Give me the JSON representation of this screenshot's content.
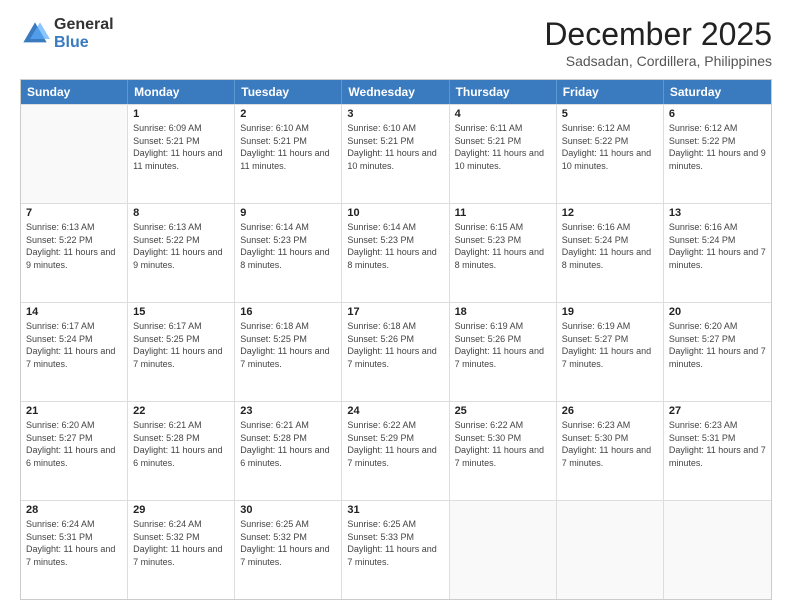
{
  "logo": {
    "general": "General",
    "blue": "Blue"
  },
  "title": "December 2025",
  "subtitle": "Sadsadan, Cordillera, Philippines",
  "days_of_week": [
    "Sunday",
    "Monday",
    "Tuesday",
    "Wednesday",
    "Thursday",
    "Friday",
    "Saturday"
  ],
  "weeks": [
    [
      {
        "day": "",
        "sunrise": "",
        "sunset": "",
        "daylight": ""
      },
      {
        "day": "1",
        "sunrise": "6:09 AM",
        "sunset": "5:21 PM",
        "daylight": "11 hours and 11 minutes."
      },
      {
        "day": "2",
        "sunrise": "6:10 AM",
        "sunset": "5:21 PM",
        "daylight": "11 hours and 11 minutes."
      },
      {
        "day": "3",
        "sunrise": "6:10 AM",
        "sunset": "5:21 PM",
        "daylight": "11 hours and 10 minutes."
      },
      {
        "day": "4",
        "sunrise": "6:11 AM",
        "sunset": "5:21 PM",
        "daylight": "11 hours and 10 minutes."
      },
      {
        "day": "5",
        "sunrise": "6:12 AM",
        "sunset": "5:22 PM",
        "daylight": "11 hours and 10 minutes."
      },
      {
        "day": "6",
        "sunrise": "6:12 AM",
        "sunset": "5:22 PM",
        "daylight": "11 hours and 9 minutes."
      }
    ],
    [
      {
        "day": "7",
        "sunrise": "6:13 AM",
        "sunset": "5:22 PM",
        "daylight": "11 hours and 9 minutes."
      },
      {
        "day": "8",
        "sunrise": "6:13 AM",
        "sunset": "5:22 PM",
        "daylight": "11 hours and 9 minutes."
      },
      {
        "day": "9",
        "sunrise": "6:14 AM",
        "sunset": "5:23 PM",
        "daylight": "11 hours and 8 minutes."
      },
      {
        "day": "10",
        "sunrise": "6:14 AM",
        "sunset": "5:23 PM",
        "daylight": "11 hours and 8 minutes."
      },
      {
        "day": "11",
        "sunrise": "6:15 AM",
        "sunset": "5:23 PM",
        "daylight": "11 hours and 8 minutes."
      },
      {
        "day": "12",
        "sunrise": "6:16 AM",
        "sunset": "5:24 PM",
        "daylight": "11 hours and 8 minutes."
      },
      {
        "day": "13",
        "sunrise": "6:16 AM",
        "sunset": "5:24 PM",
        "daylight": "11 hours and 7 minutes."
      }
    ],
    [
      {
        "day": "14",
        "sunrise": "6:17 AM",
        "sunset": "5:24 PM",
        "daylight": "11 hours and 7 minutes."
      },
      {
        "day": "15",
        "sunrise": "6:17 AM",
        "sunset": "5:25 PM",
        "daylight": "11 hours and 7 minutes."
      },
      {
        "day": "16",
        "sunrise": "6:18 AM",
        "sunset": "5:25 PM",
        "daylight": "11 hours and 7 minutes."
      },
      {
        "day": "17",
        "sunrise": "6:18 AM",
        "sunset": "5:26 PM",
        "daylight": "11 hours and 7 minutes."
      },
      {
        "day": "18",
        "sunrise": "6:19 AM",
        "sunset": "5:26 PM",
        "daylight": "11 hours and 7 minutes."
      },
      {
        "day": "19",
        "sunrise": "6:19 AM",
        "sunset": "5:27 PM",
        "daylight": "11 hours and 7 minutes."
      },
      {
        "day": "20",
        "sunrise": "6:20 AM",
        "sunset": "5:27 PM",
        "daylight": "11 hours and 7 minutes."
      }
    ],
    [
      {
        "day": "21",
        "sunrise": "6:20 AM",
        "sunset": "5:27 PM",
        "daylight": "11 hours and 6 minutes."
      },
      {
        "day": "22",
        "sunrise": "6:21 AM",
        "sunset": "5:28 PM",
        "daylight": "11 hours and 6 minutes."
      },
      {
        "day": "23",
        "sunrise": "6:21 AM",
        "sunset": "5:28 PM",
        "daylight": "11 hours and 6 minutes."
      },
      {
        "day": "24",
        "sunrise": "6:22 AM",
        "sunset": "5:29 PM",
        "daylight": "11 hours and 7 minutes."
      },
      {
        "day": "25",
        "sunrise": "6:22 AM",
        "sunset": "5:30 PM",
        "daylight": "11 hours and 7 minutes."
      },
      {
        "day": "26",
        "sunrise": "6:23 AM",
        "sunset": "5:30 PM",
        "daylight": "11 hours and 7 minutes."
      },
      {
        "day": "27",
        "sunrise": "6:23 AM",
        "sunset": "5:31 PM",
        "daylight": "11 hours and 7 minutes."
      }
    ],
    [
      {
        "day": "28",
        "sunrise": "6:24 AM",
        "sunset": "5:31 PM",
        "daylight": "11 hours and 7 minutes."
      },
      {
        "day": "29",
        "sunrise": "6:24 AM",
        "sunset": "5:32 PM",
        "daylight": "11 hours and 7 minutes."
      },
      {
        "day": "30",
        "sunrise": "6:25 AM",
        "sunset": "5:32 PM",
        "daylight": "11 hours and 7 minutes."
      },
      {
        "day": "31",
        "sunrise": "6:25 AM",
        "sunset": "5:33 PM",
        "daylight": "11 hours and 7 minutes."
      },
      {
        "day": "",
        "sunrise": "",
        "sunset": "",
        "daylight": ""
      },
      {
        "day": "",
        "sunrise": "",
        "sunset": "",
        "daylight": ""
      },
      {
        "day": "",
        "sunrise": "",
        "sunset": "",
        "daylight": ""
      }
    ]
  ]
}
